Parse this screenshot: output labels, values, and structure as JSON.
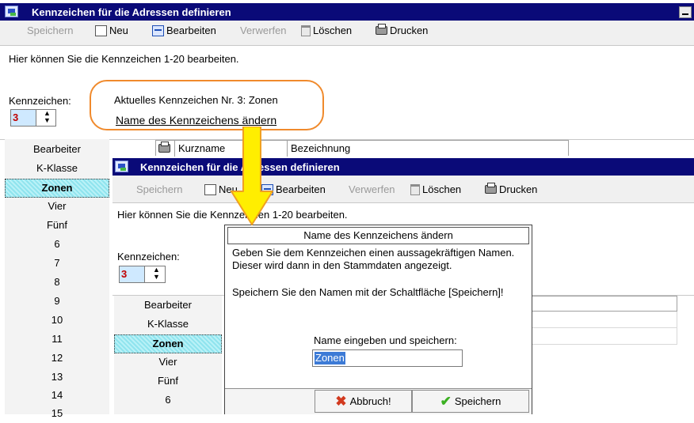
{
  "window": {
    "title": "Kennzeichen für die Adressen definieren",
    "toolbar": {
      "save": "Speichern",
      "new": "Neu",
      "edit": "Bearbeiten",
      "discard": "Verwerfen",
      "delete": "Löschen",
      "print": "Drucken"
    },
    "info": "Hier können Sie die Kennzeichen 1-20 bearbeiten.",
    "kennzeichen_label": "Kennzeichen:",
    "kennzeichen_value": "3",
    "current_text": "Aktuelles Kennzeichen Nr. 3: Zonen",
    "rename_link": "Name des Kennzeichens ändern",
    "grid_headers": {
      "kurzname": "Kurzname",
      "bezeichnung": "Bezeichnung"
    }
  },
  "sidebar_back": {
    "items": [
      "Bearbeiter",
      "K-Klasse",
      "Zonen",
      "Vier",
      "Fünf",
      "6",
      "7",
      "8",
      "9",
      "10",
      "11",
      "12",
      "13",
      "14",
      "15"
    ],
    "selected": "Zonen"
  },
  "sidebar_front": {
    "items": [
      "Bearbeiter",
      "K-Klasse",
      "Zonen",
      "Vier",
      "Fünf",
      "6"
    ],
    "selected": "Zonen"
  },
  "dialog": {
    "title": "Name des Kennzeichens ändern",
    "line1": "Geben Sie dem Kennzeichen einen aussagekräftigen Namen.",
    "line2": "Dieser wird dann in den Stammdaten angezeigt.",
    "line3": "Speichern Sie den Namen mit der Schaltfläche [Speichern]!",
    "input_label": "Name eingeben und speichern:",
    "input_value": "Zonen",
    "cancel": "Abbruch!",
    "save": "Speichern"
  },
  "colors": {
    "titlebar": "#0a0a78",
    "highlight_orange": "#f08a2c",
    "arrow_yellow": "#ffee00",
    "selection": "#3d7bd6"
  },
  "icons": [
    "app-icon",
    "minimize-icon",
    "new-icon",
    "edit-icon",
    "delete-icon",
    "print-icon",
    "spin-arrows-icon",
    "cancel-x-icon",
    "save-check-icon",
    "down-arrow-icon"
  ]
}
